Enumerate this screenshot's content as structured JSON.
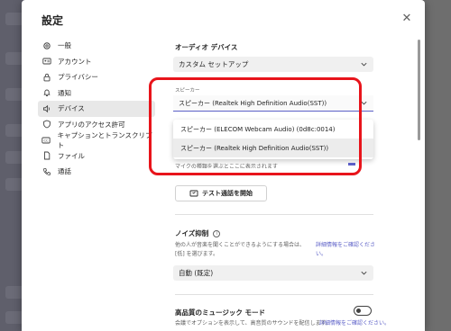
{
  "dialog": {
    "title": "設定",
    "close_icon": "close-icon"
  },
  "nav": {
    "items": [
      {
        "label": "一般",
        "icon": "gear-icon"
      },
      {
        "label": "アカウント",
        "icon": "id-card-icon"
      },
      {
        "label": "プライバシー",
        "icon": "lock-icon"
      },
      {
        "label": "通知",
        "icon": "bell-icon"
      },
      {
        "label": "デバイス",
        "icon": "speaker-icon",
        "active": true
      },
      {
        "label": "アプリのアクセス許可",
        "icon": "shield-icon"
      },
      {
        "label": "キャプションとトランスクリプト",
        "icon": "cc-icon"
      },
      {
        "label": "ファイル",
        "icon": "file-icon"
      },
      {
        "label": "通話",
        "icon": "phone-icon"
      }
    ]
  },
  "audio": {
    "section_title": "オーディオ デバイス",
    "device_select": "カスタム セットアップ"
  },
  "speaker": {
    "label": "スピーカー",
    "selected": "スピーカー (Realtek High Definition Audio(SST))",
    "options": [
      "スピーカー (ELECOM Webcam Audio) (0d8c:0014)",
      "スピーカー (Realtek High Definition Audio(SST))"
    ],
    "hidden_row": "マイクの種類を選ぶとここに表示されます"
  },
  "test_call_button": "テスト通話を開始",
  "noise": {
    "title": "ノイズ抑制",
    "description": "他の人が音楽を聞くことができるようにする場合は、[低] を選びます。",
    "link": "詳細情報をご確認ください。",
    "select": "自動 (既定)"
  },
  "music_mode": {
    "title": "高品質のミュージック モード",
    "description": "会議でオプションを表示して、高音質のサウンドを配信します。",
    "link": "詳細情報をご確認ください。"
  },
  "colors": {
    "highlight": "#e8141b",
    "accent": "#5b5fc7"
  }
}
